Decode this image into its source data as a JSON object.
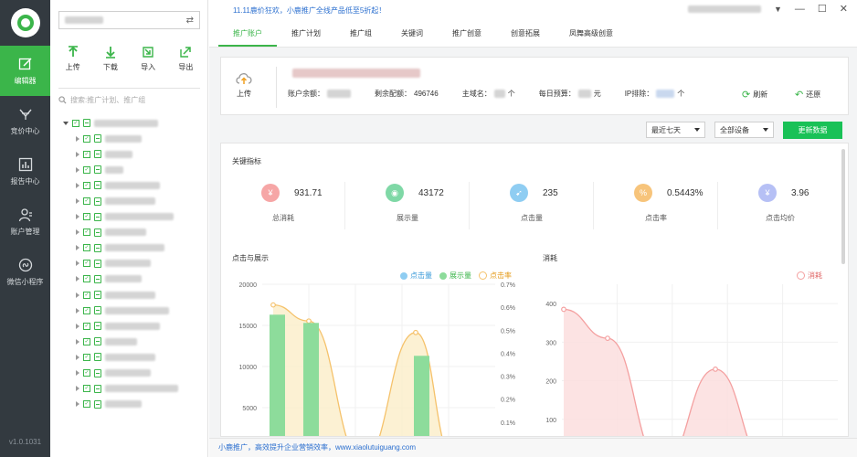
{
  "app": {
    "version": "v1.0.1031"
  },
  "nav": [
    {
      "label": "编辑器",
      "icon": "edit-icon",
      "active": true
    },
    {
      "label": "竞价中心",
      "icon": "bid-icon"
    },
    {
      "label": "报告中心",
      "icon": "report-icon"
    },
    {
      "label": "账户管理",
      "icon": "user-icon"
    },
    {
      "label": "微信小程序",
      "icon": "mini-program-icon"
    }
  ],
  "tree": {
    "toolbar": [
      {
        "label": "上传",
        "icon": "upload-arrow-icon"
      },
      {
        "label": "下载",
        "icon": "download-arrow-icon"
      },
      {
        "label": "导入",
        "icon": "import-icon"
      },
      {
        "label": "导出",
        "icon": "export-icon"
      }
    ],
    "search_placeholder": "搜索:推广计划、推广组"
  },
  "header": {
    "promo": "11.11鹿价狂欢，小鹿推广全线产品低至5折起！",
    "tabs": [
      "推广账户",
      "推广计划",
      "推广组",
      "关键词",
      "推广创意",
      "创意拓展",
      "凤舞高级创意"
    ],
    "active_tab": 0
  },
  "account": {
    "upload_label": "上传",
    "balance_label": "账户余额：",
    "quota_label": "剩余配额：",
    "quota_value": "496746",
    "domain_label": "主域名：",
    "domain_suffix": "个",
    "budget_label": "每日预算：",
    "budget_suffix": "元",
    "ip_label": "IP排除：",
    "ip_suffix": "个",
    "refresh_label": "刷新",
    "restore_label": "还原"
  },
  "filters": {
    "period": "最近七天",
    "device": "全部设备",
    "update_label": "更新数据"
  },
  "metrics": {
    "title": "关键指标",
    "items": [
      {
        "value": "931.71",
        "label": "总消耗",
        "icon": "yen-icon",
        "color": "#f6a6a6"
      },
      {
        "value": "43172",
        "label": "展示量",
        "icon": "eye-icon",
        "color": "#7fd8a6"
      },
      {
        "value": "235",
        "label": "点击量",
        "icon": "cursor-icon",
        "color": "#8fcdf2"
      },
      {
        "value": "0.5443%",
        "label": "点击率",
        "icon": "percent-icon",
        "color": "#f7c47b"
      },
      {
        "value": "3.96",
        "label": "点击均价",
        "icon": "coin-icon",
        "color": "#b6c0f5"
      }
    ]
  },
  "colors": {
    "accent": "#3bb54a",
    "button": "#19c157",
    "nav_bg": "#333a40"
  },
  "chart_data": [
    {
      "type": "bar",
      "title": "点击与展示",
      "legend": [
        "点击量",
        "展示量",
        "点击率"
      ],
      "legend_placement": "top-right",
      "yticks_left": [
        "20000",
        "15000",
        "10000",
        "5000"
      ],
      "yticks_right": [
        "0.7%",
        "0.6%",
        "0.5%",
        "0.4%",
        "0.3%",
        "0.2%",
        "0.1%"
      ],
      "ylim": [
        0,
        20000
      ],
      "ylim_right": [
        0,
        0.7
      ],
      "series": [
        {
          "name": "展示量",
          "type": "bar",
          "color": "#8ddc9b",
          "values": [
            16300,
            15300,
            null,
            11300
          ]
        },
        {
          "name": "点击率",
          "type": "area",
          "color": "#f5c26b",
          "values": [
            0.61,
            0.54,
            null,
            0.49,
            0.1
          ]
        }
      ]
    },
    {
      "type": "area",
      "title": "消耗",
      "legend": [
        "消耗"
      ],
      "legend_placement": "top-right",
      "yticks": [
        "400",
        "300",
        "200",
        "100"
      ],
      "ylim": [
        0,
        400
      ],
      "series": [
        {
          "name": "消耗",
          "color": "#f4a0a0",
          "values": [
            385,
            310,
            60,
            230,
            40
          ]
        }
      ]
    }
  ],
  "footer": "小鹿推广，高效提升企业营销效率，www.xiaolutuiguang.com"
}
